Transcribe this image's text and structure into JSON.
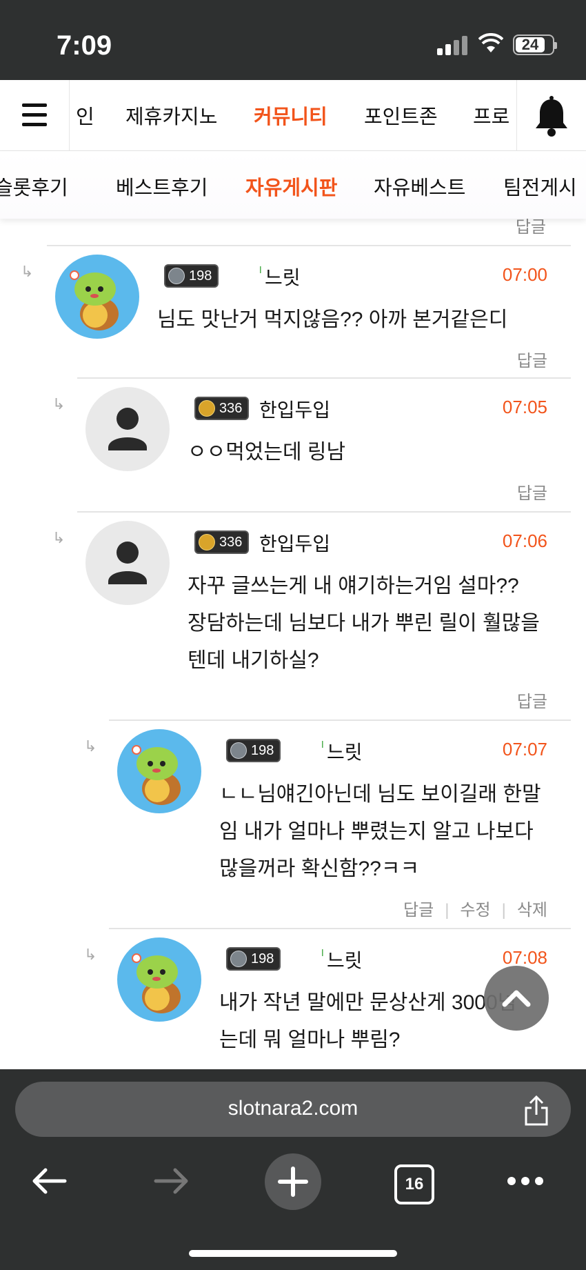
{
  "status": {
    "time": "7:09",
    "battery": "24"
  },
  "nav_primary": {
    "items": [
      {
        "label": "인",
        "active": false
      },
      {
        "label": "제휴카지노",
        "active": false
      },
      {
        "label": "커뮤니티",
        "active": true
      },
      {
        "label": "포인트존",
        "active": false
      },
      {
        "label": "프로",
        "active": false
      }
    ]
  },
  "nav_secondary": {
    "items": [
      {
        "label": "슬롯후기",
        "active": false
      },
      {
        "label": "베스트후기",
        "active": false
      },
      {
        "label": "자유게시판",
        "active": true
      },
      {
        "label": "자유베스트",
        "active": false
      },
      {
        "label": "팀전게시",
        "active": false
      }
    ]
  },
  "top_reply_label": "답글",
  "comments": [
    {
      "level": "198",
      "nickname": "느릿",
      "time": "07:00",
      "body": "님도 맛난거 먹지않음?? 아까 본거같은디",
      "actions": [
        "답글"
      ]
    },
    {
      "level": "336",
      "nickname": "한입두입",
      "time": "07:05",
      "body": "ㅇㅇ먹었는데 링남",
      "actions": [
        "답글"
      ]
    },
    {
      "level": "336",
      "nickname": "한입두입",
      "time": "07:06",
      "body_lines": [
        "자꾸 글쓰는게 내 얘기하는거임 설마??",
        "장담하는데 님보다 내가 뿌린 릴이 훨많을",
        "텐데 내기하실?"
      ],
      "actions": [
        "답글"
      ]
    },
    {
      "level": "198",
      "nickname": "느릿",
      "time": "07:07",
      "body_lines": [
        "ㄴㄴ님얘긴아닌데 님도 보이길래 한말",
        "임 내가 얼마나 뿌렸는지 알고 나보다",
        "많을꺼라 확신함??ㅋㅋ"
      ],
      "actions": [
        "답글",
        "수정",
        "삭제"
      ]
    },
    {
      "level": "198",
      "nickname": "느릿",
      "time": "07:08",
      "body_lines": [
        "내가 작년 말에만 문상산게 3000넘",
        "는데 뭐 얼마나 뿌림?"
      ]
    }
  ],
  "browser": {
    "url": "slotnara2.com",
    "tab_count": "16"
  }
}
